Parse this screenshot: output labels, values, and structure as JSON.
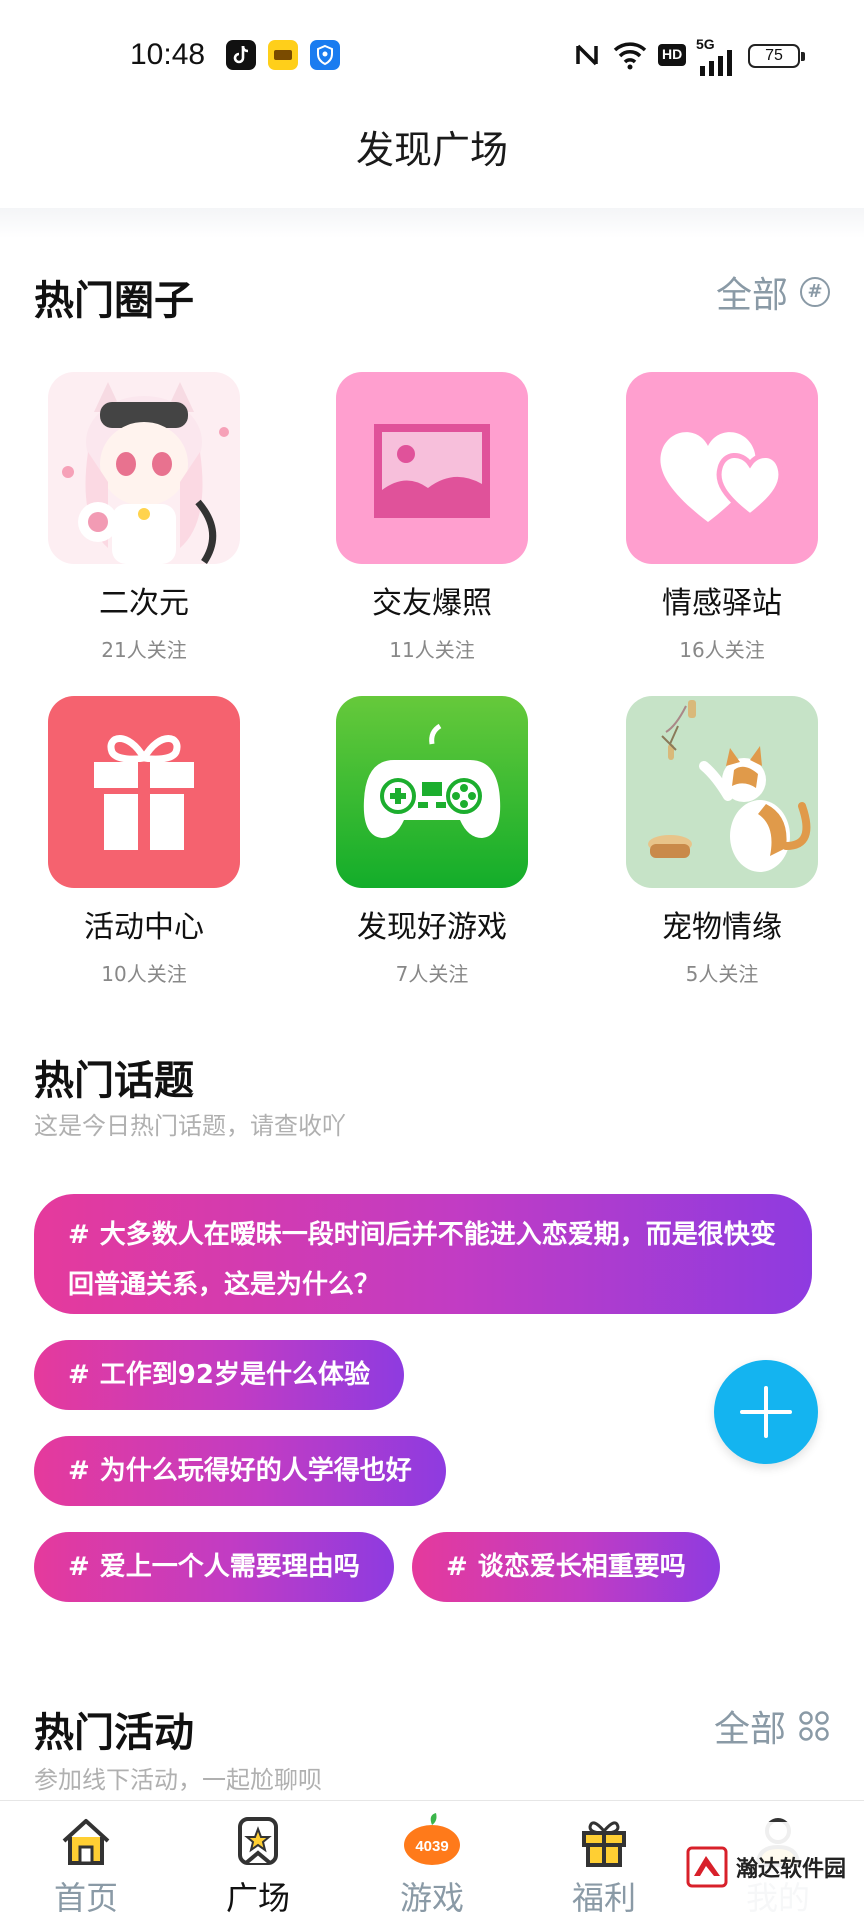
{
  "status_bar": {
    "time": "10:48",
    "battery": "75",
    "network": "5G",
    "hd_badge": "HD",
    "icons": [
      "tiktok-icon",
      "taobao-icon",
      "location-shield-icon",
      "nfc-icon",
      "wifi-icon",
      "signal-icon",
      "battery-icon"
    ]
  },
  "header": {
    "title": "发现广场"
  },
  "hot_circles": {
    "title": "热门圈子",
    "all_label": "全部",
    "items": [
      {
        "name": "二次元",
        "count": "21人关注",
        "icon": "anime-cat-girl-image"
      },
      {
        "name": "交友爆照",
        "count": "11人关注",
        "icon": "photo-icon"
      },
      {
        "name": "情感驿站",
        "count": "16人关注",
        "icon": "hearts-icon"
      },
      {
        "name": "活动中心",
        "count": "10人关注",
        "icon": "gift-icon"
      },
      {
        "name": "发现好游戏",
        "count": "7人关注",
        "icon": "gamepad-icon"
      },
      {
        "name": "宠物情缘",
        "count": "5人关注",
        "icon": "cat-image"
      }
    ]
  },
  "hot_topics": {
    "title": "热门话题",
    "subtitle": "这是今日热门话题，请查收吖",
    "items": [
      {
        "hash": "#",
        "text": "大多数人在暧昧一段时间后并不能进入恋爱期，而是很快变回普通关系，这是为什么？"
      },
      {
        "hash": "#",
        "text": "工作到92岁是什么体验"
      },
      {
        "hash": "#",
        "text": "为什么玩得好的人学得也好"
      },
      {
        "hash": "#",
        "text": "爱上一个人需要理由吗"
      },
      {
        "hash": "#",
        "text": "谈恋爱长相重要吗"
      }
    ]
  },
  "hot_events": {
    "title": "热门活动",
    "subtitle": "参加线下活动，一起尬聊呗",
    "all_label": "全部"
  },
  "bottom_nav": [
    {
      "label": "首页",
      "icon": "home-icon",
      "active": false
    },
    {
      "label": "广场",
      "icon": "plaza-star-icon",
      "active": true
    },
    {
      "label": "游戏",
      "icon": "4039-game-icon",
      "active": false
    },
    {
      "label": "福利",
      "icon": "gift-icon",
      "active": false
    },
    {
      "label": "我的",
      "icon": "user-icon",
      "active": false
    }
  ],
  "game_badge": "4039",
  "watermark": "瀚达软件园",
  "colors": {
    "topic_gradient_start": "#e53a9c",
    "topic_gradient_end": "#8e3be0",
    "fab": "#14b4f0",
    "pink_tile": "#ff9fcf",
    "red_tile": "#f5626f",
    "green_tile": "#2dbb2b",
    "muted_text": "#8a9aa6"
  }
}
